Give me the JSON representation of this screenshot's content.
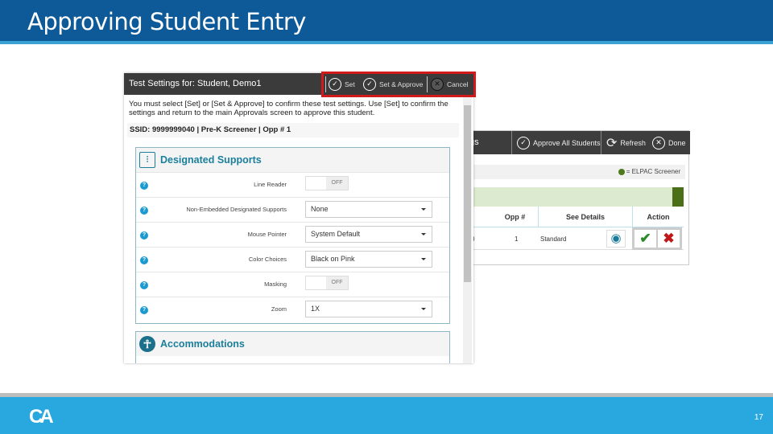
{
  "slide": {
    "title": "Approving Student Entry",
    "page_number": "17",
    "logo_text": "CA",
    "colors": {
      "header": "#0e5a98",
      "footer": "#29a8df",
      "highlight": "#d21a1a"
    }
  },
  "approvals": {
    "header_partial": "gs",
    "buttons": [
      {
        "label": "Approve All Students",
        "icon": "check-circle-icon"
      },
      {
        "label": "Refresh",
        "icon": "refresh-icon"
      },
      {
        "label": "Done",
        "icon": "close-circle-icon"
      }
    ],
    "legend": "= ELPAC Screener",
    "columns": [
      "Opp #",
      "See Details",
      "Action"
    ],
    "row": {
      "partial": "0",
      "opp": "1",
      "details": "Standard"
    }
  },
  "dialog": {
    "title": "Test Settings for: Student, Demo1",
    "buttons": [
      {
        "label": "Set",
        "icon": "check-circle-icon"
      },
      {
        "label": "Set & Approve",
        "icon": "check-circle-icon"
      },
      {
        "label": "Cancel",
        "icon": "close-circle-icon"
      }
    ],
    "message": "You must select [Set] or [Set & Approve] to confirm these test settings. Use [Set] to confirm the settings and return to the main Approvals screen to approve this student.",
    "ssid": "SSID: 9999999040 | Pre-K Screener | Opp # 1",
    "designated_supports": {
      "title": "Designated Supports",
      "settings": [
        {
          "label": "Line Reader",
          "type": "toggle",
          "value": "OFF"
        },
        {
          "label": "Non-Embedded Designated Supports",
          "type": "select",
          "value": "None"
        },
        {
          "label": "Mouse Pointer",
          "type": "select",
          "value": "System Default"
        },
        {
          "label": "Color Choices",
          "type": "select",
          "value": "Black on Pink"
        },
        {
          "label": "Masking",
          "type": "toggle",
          "value": "OFF"
        },
        {
          "label": "Zoom",
          "type": "select",
          "value": "1X"
        }
      ]
    },
    "accommodations": {
      "title": "Accommodations"
    }
  }
}
